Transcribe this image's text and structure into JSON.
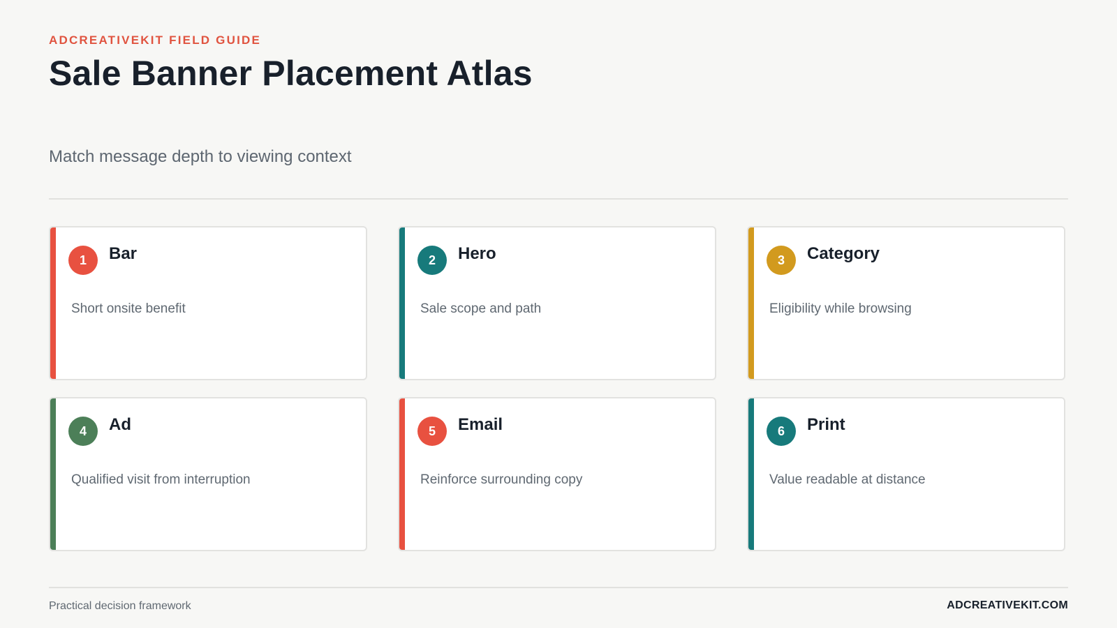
{
  "header": {
    "eyebrow": "ADCREATIVEKIT FIELD GUIDE",
    "title": "Sale Banner Placement Atlas",
    "subtitle": "Match message depth to viewing context"
  },
  "colors": {
    "coral": "#e85140",
    "teal": "#177a7b",
    "gold": "#d29a1e",
    "green": "#4c7f58"
  },
  "cards": [
    {
      "number": "1",
      "title": "Bar",
      "description": "Short onsite benefit",
      "color": "#e85140"
    },
    {
      "number": "2",
      "title": "Hero",
      "description": "Sale scope and path",
      "color": "#177a7b"
    },
    {
      "number": "3",
      "title": "Category",
      "description": "Eligibility while browsing",
      "color": "#d29a1e"
    },
    {
      "number": "4",
      "title": "Ad",
      "description": "Qualified visit from interruption",
      "color": "#4c7f58"
    },
    {
      "number": "5",
      "title": "Email",
      "description": "Reinforce surrounding copy",
      "color": "#e85140"
    },
    {
      "number": "6",
      "title": "Print",
      "description": "Value readable at distance",
      "color": "#177a7b"
    }
  ],
  "footer": {
    "left": "Practical decision framework",
    "right": "ADCREATIVEKIT.COM"
  }
}
